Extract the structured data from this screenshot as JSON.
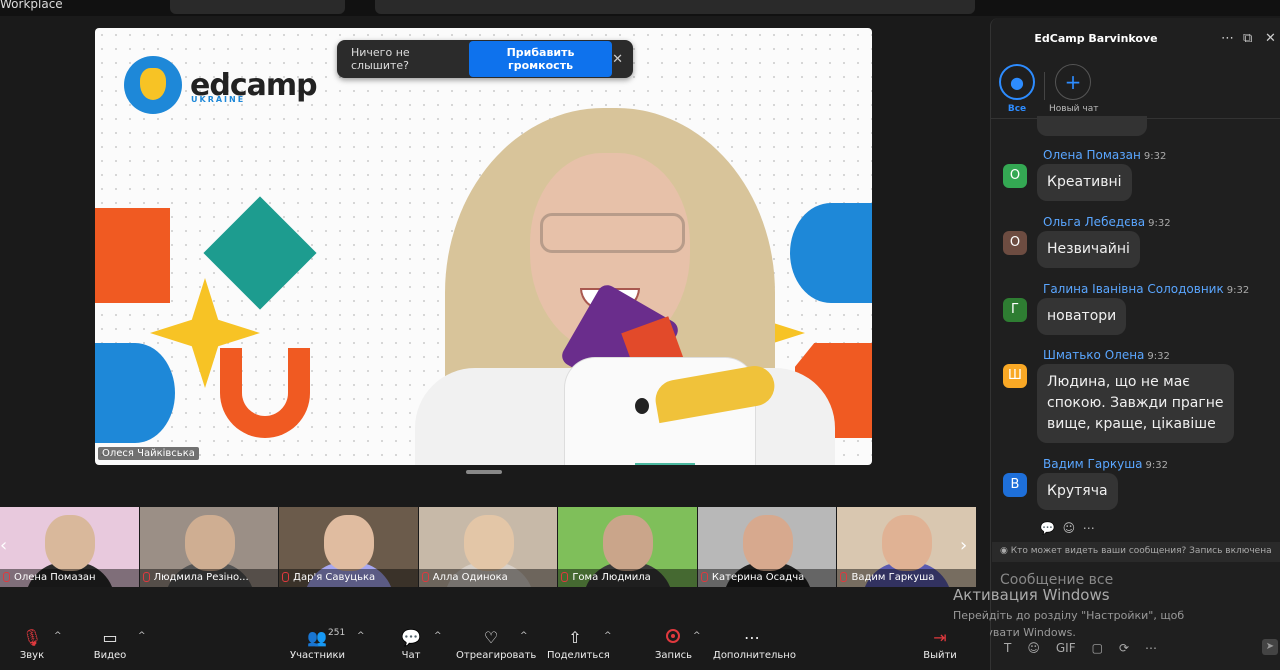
{
  "app": {
    "title": "Workplace"
  },
  "meeting": {
    "toast": {
      "text": "Ничего не слышите?",
      "button": "Прибавить громкость"
    },
    "active_speaker": "Олеся Чайківська",
    "logo": {
      "text": "edcamp",
      "sub": "UKRAINE"
    }
  },
  "gallery": [
    {
      "name": "Олена Помазан",
      "bg": "#e8c9dd",
      "head": "#d9b89b",
      "body": "#2b2b2b"
    },
    {
      "name": "Людмила Резіно...",
      "bg": "#9b8f86",
      "head": "#cfae92",
      "body": "#555"
    },
    {
      "name": "Дар'я Савуцька",
      "bg": "#6b5b4b",
      "head": "#e0bca0",
      "body": "#a7a7f0"
    },
    {
      "name": "Алла Одинока",
      "bg": "#c7b9a8",
      "head": "#e3c6a7",
      "body": "#d8d0c8"
    },
    {
      "name": "Гома Людмила",
      "bg": "#7fbf5a",
      "head": "#caa58a",
      "body": "#3a3a3a"
    },
    {
      "name": "Катерина Осадча",
      "bg": "#b8b8b8",
      "head": "#d7a98e",
      "body": "#1e1e1e"
    },
    {
      "name": "Вадим Гаркуша",
      "bg": "#d9c7b0",
      "head": "#e0b294",
      "body": "#5b5bb0"
    }
  ],
  "chat": {
    "title": "EdCamp Barvinkove",
    "channels": [
      {
        "label": "Все"
      },
      {
        "label": "Новый чат"
      }
    ],
    "messages": [
      {
        "sender": "Олена Помазан",
        "time": "9:32",
        "initial": "О",
        "color": "#34a853",
        "lines": [
          "Креативні"
        ]
      },
      {
        "sender": "Ольга Лебедєва",
        "time": "9:32",
        "initial": "О",
        "color": "#6d4c41",
        "lines": [
          "Незвичайні"
        ]
      },
      {
        "sender": "Галина Іванівна Солодовник",
        "time": "9:32",
        "initial": "Г",
        "color": "#2e7d32",
        "lines": [
          "новатори"
        ]
      },
      {
        "sender": "Шматько Олена",
        "time": "9:32",
        "initial": "Ш",
        "color": "#f9a825",
        "lines": [
          "Людина, що не має",
          "спокою. Завжди прагне",
          "вище, краще, цікавіше"
        ]
      },
      {
        "sender": "Вадим Гаркуша",
        "time": "9:32",
        "initial": "В",
        "color": "#1e6fd9",
        "lines": [
          "Крутяча"
        ]
      }
    ],
    "who_sees": "Кто может видеть ваши сообщения? Запись включена",
    "compose_placeholder": "Сообщение все",
    "tools": [
      "T",
      "☺",
      "GIF",
      "▢",
      "⟳",
      "⋯"
    ]
  },
  "watermark": {
    "title": "Активация Windows",
    "subtitle": "Перейдіть до розділу \"Настройки\", щоб активувати Windows."
  },
  "toolbar": {
    "audio": "Звук",
    "video": "Видео",
    "participants": "Участники",
    "participants_count": "251",
    "chat": "Чат",
    "react": "Отреагировать",
    "share": "Поделиться",
    "record": "Запись",
    "more": "Дополнительно",
    "leave": "Выйти"
  }
}
